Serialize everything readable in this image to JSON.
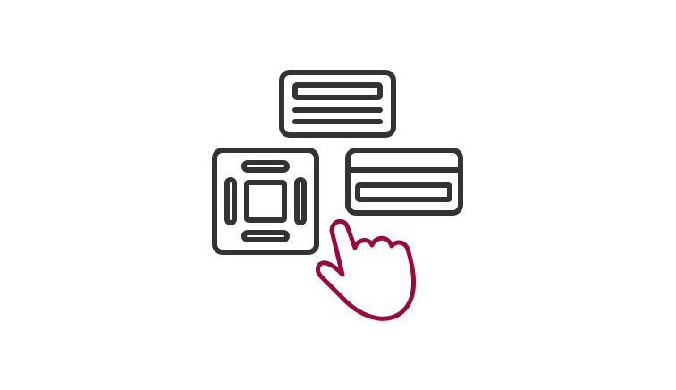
{
  "icons": {
    "panel_top": "text-block-card-icon",
    "panel_left": "layout-grid-card-icon",
    "panel_right": "input-field-card-icon",
    "pointer": "pointing-hand-icon"
  },
  "colors": {
    "background": "#ffffff",
    "outline": "#333333",
    "accent": "#9b0a3e"
  }
}
